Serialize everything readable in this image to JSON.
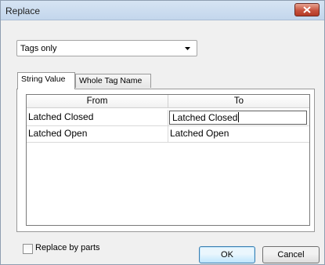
{
  "window": {
    "title": "Replace"
  },
  "scope": {
    "selected": "Tags only"
  },
  "tabs": [
    {
      "label": "String Value",
      "active": true
    },
    {
      "label": "Whole Tag Name",
      "active": false
    }
  ],
  "grid": {
    "columns": [
      "From",
      "To"
    ],
    "rows": [
      {
        "from": "Latched Closed",
        "to": "Latched Closed",
        "editing": true
      },
      {
        "from": "Latched Open",
        "to": "Latched Open",
        "editing": false
      }
    ]
  },
  "options": {
    "replace_by_parts_label": "Replace by parts",
    "replace_by_parts_checked": false
  },
  "buttons": {
    "ok": "OK",
    "cancel": "Cancel"
  },
  "colors": {
    "close_button": "#c7533e",
    "default_button_border": "#3c7fb1"
  }
}
